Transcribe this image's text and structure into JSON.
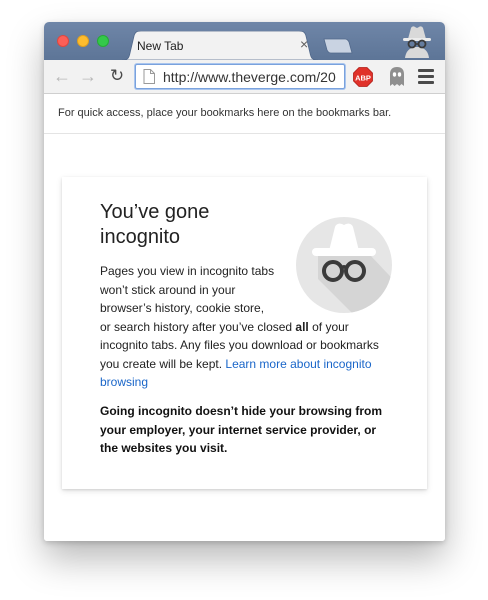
{
  "tab": {
    "title": "New Tab",
    "close_symbol": "×"
  },
  "toolbar": {
    "back_icon": "←",
    "forward_icon": "→",
    "reload_icon": "↻",
    "url": "http://www.theverge.com/20",
    "extensions": [
      {
        "name": "adblock-plus",
        "label": "ABP",
        "color": "#e0322a"
      },
      {
        "name": "ghostery",
        "label": "",
        "color": "#8f8f8f"
      }
    ]
  },
  "bookmarks_bar": {
    "hint": "For quick access, place your bookmarks here on the bookmarks bar."
  },
  "incognito_page": {
    "heading": "You’ve gone incognito",
    "para_line1": "Pages you view in incognito tabs won’t stick around in your browser’s history, cookie store,",
    "para_before_bold": "or search history after you’ve closed ",
    "para_bold": "all",
    "para_after_bold": " of your incognito tabs. Any files you download or bookmarks you create will be kept. ",
    "learn_more_link": "Learn more about incognito browsing",
    "warning": "Going incognito doesn’t hide your browsing from your employer, your internet service provider, or the websites you visit."
  },
  "colors": {
    "titlebar": "#6681a5",
    "link": "#1a66c9",
    "close_button": "#fc5f57",
    "minimize_button": "#fdbc2e",
    "maximize_button": "#34c84a"
  }
}
